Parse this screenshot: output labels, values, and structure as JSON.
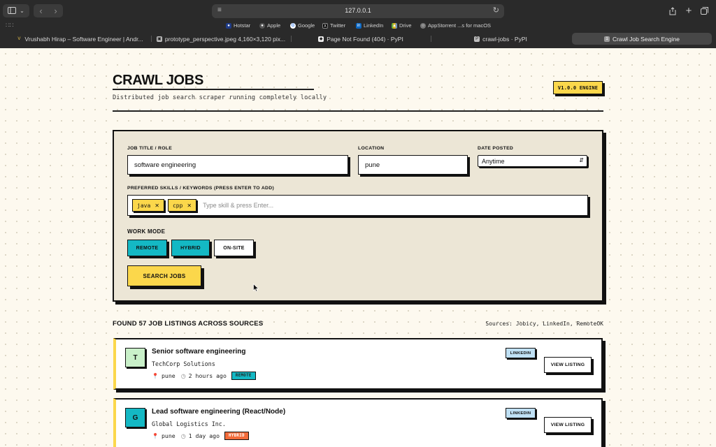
{
  "browser": {
    "url": "127.0.0.1",
    "bookmarks": [
      {
        "label": "Hotstar",
        "icon": "hotstar-icon",
        "color": "#1f3c88"
      },
      {
        "label": "Apple",
        "icon": "apple-icon",
        "color": "#555555"
      },
      {
        "label": "Google",
        "icon": "google-icon",
        "color": "#4285f4"
      },
      {
        "label": "Twitter",
        "icon": "x-icon",
        "color": "#000000"
      },
      {
        "label": "LinkedIn",
        "icon": "linkedin-icon",
        "color": "#0a66c2"
      },
      {
        "label": "Drive",
        "icon": "drive-icon",
        "color": "#34a853"
      },
      {
        "label": "AppStorrent ...s for macOS",
        "icon": "globe-icon",
        "color": "#777777"
      }
    ],
    "tabs": [
      {
        "label": "Vrushabh Hirap – Software Engineer | Andr...",
        "icon": "v-icon"
      },
      {
        "label": "prototype_perspective.jpeg 4,160×3,120 pix...",
        "icon": "image-icon"
      },
      {
        "label": "Page Not Found (404) · PyPI",
        "icon": "pypi-icon"
      },
      {
        "label": "crawl-jobs · PyPI",
        "icon": "pypi-icon"
      },
      {
        "label": "Crawl Job Search Engine",
        "icon": "page-icon"
      }
    ]
  },
  "header": {
    "title": "CRAWL JOBS",
    "subtitle": "Distributed job search scraper running completely locally",
    "version": "V1.0.0 ENGINE"
  },
  "form": {
    "job_title_label": "JOB TITLE / ROLE",
    "job_title_value": "software engineering",
    "location_label": "LOCATION",
    "location_value": "pune",
    "date_label": "DATE POSTED",
    "date_value": "Anytime",
    "skills_label": "PREFERRED SKILLS / KEYWORDS (PRESS ENTER TO ADD)",
    "skills": [
      "java",
      "cpp"
    ],
    "skills_placeholder": "Type skill & press Enter...",
    "work_mode_label": "WORK MODE",
    "modes": [
      {
        "label": "REMOTE",
        "selected": true
      },
      {
        "label": "HYBRID",
        "selected": true
      },
      {
        "label": "ON-SITE",
        "selected": false
      }
    ],
    "search_label": "SEARCH JOBS"
  },
  "results": {
    "heading": "FOUND 57 JOB LISTINGS ACROSS SOURCES",
    "sources": "Sources: Jobicy, LinkedIn, RemoteOK",
    "jobs": [
      {
        "initial": "T",
        "avatar_color": "#c9f0c9",
        "title": "Senior software engineering",
        "company": "TechCorp Solutions",
        "location": "pune",
        "posted": "2 hours ago",
        "mode": "REMOTE",
        "mode_color": "#14b8c4",
        "source": "LINKEDIN",
        "action": "VIEW LISTING"
      },
      {
        "initial": "G",
        "avatar_color": "#14b8c4",
        "title": "Lead software engineering (React/Node)",
        "company": "Global Logistics Inc.",
        "location": "pune",
        "posted": "1 day ago",
        "mode": "HYBRID",
        "mode_color": "#f26b3a",
        "source": "LINKEDIN",
        "action": "VIEW LISTING"
      }
    ]
  }
}
